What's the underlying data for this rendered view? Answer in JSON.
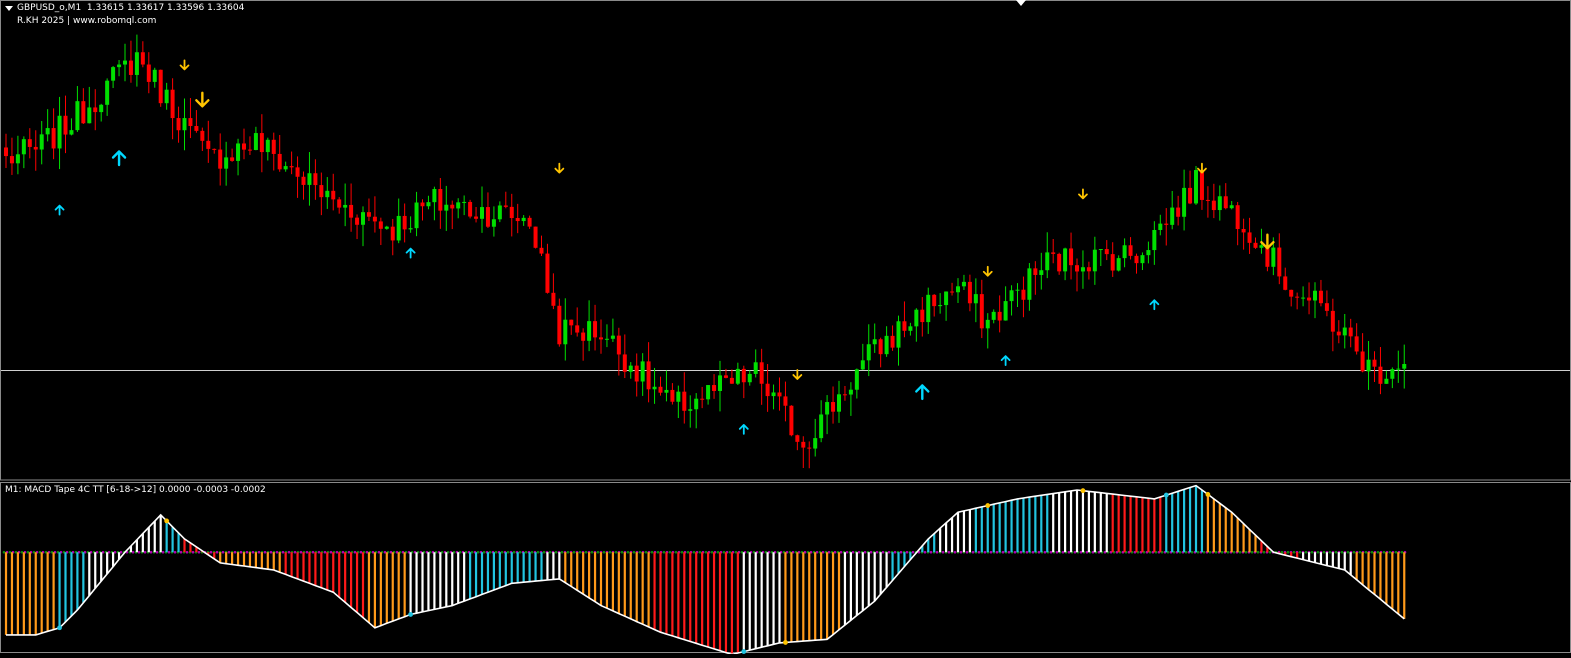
{
  "main_window": {
    "symbol_header": "GBPUSD_o,M1  1.33615 1.33617 1.33596 1.33604",
    "credit": "R.KH 2025 | www.robomql.com"
  },
  "indicator_window": {
    "header": "M1: MACD Tape 4C TT [6-18->12] 0.0000 -0.0003 -0.0002"
  },
  "colors": {
    "background": "#000000",
    "bull_candle": "#00e000",
    "bear_candle": "#ff0000",
    "buy_arrow": "#00d8ff",
    "sell_arrow": "#ffc400",
    "hline": "#d0d0d0",
    "macd_line": "#ffffff",
    "signal_dots": "#b000b0",
    "zero_dots": "#0a8a0a",
    "tape_white": "#ffffff",
    "tape_cyan": "#22c4e0",
    "tape_orange": "#ff9a1a",
    "tape_red": "#ff1a1a",
    "frame_border": "#8a8a8a"
  },
  "chart_data": [
    {
      "type": "candlestick",
      "symbol": "GBPUSD_o",
      "timeframe": "M1",
      "ylim": [
        1.335,
        1.34
      ],
      "price_levels": {
        "top": 1.34,
        "bottom": 1.335
      },
      "hline_price": 1.33604,
      "anchors": [
        [
          0,
          1.3385
        ],
        [
          5,
          1.3386
        ],
        [
          12,
          1.339
        ],
        [
          22,
          1.3397
        ],
        [
          27,
          1.3392
        ],
        [
          34,
          1.3385
        ],
        [
          42,
          1.3387
        ],
        [
          55,
          1.338
        ],
        [
          65,
          1.3377
        ],
        [
          72,
          1.338
        ],
        [
          80,
          1.3379
        ],
        [
          88,
          1.3378
        ],
        [
          93,
          1.3365
        ],
        [
          100,
          1.3365
        ],
        [
          112,
          1.3356
        ],
        [
          126,
          1.336
        ],
        [
          134,
          1.3352
        ],
        [
          145,
          1.3362
        ],
        [
          155,
          1.3368
        ],
        [
          160,
          1.337
        ],
        [
          165,
          1.3366
        ],
        [
          175,
          1.3373
        ],
        [
          190,
          1.3374
        ],
        [
          200,
          1.3382
        ],
        [
          208,
          1.3378
        ],
        [
          216,
          1.337
        ],
        [
          222,
          1.3367
        ],
        [
          230,
          1.336
        ],
        [
          235,
          1.3362
        ]
      ],
      "buy_arrows": [
        [
          9,
          1.3379
        ],
        [
          19,
          1.3385
        ],
        [
          68,
          1.3374
        ],
        [
          124,
          1.33535
        ],
        [
          154,
          1.33578
        ],
        [
          168,
          1.33615
        ],
        [
          193,
          1.3368
        ]
      ],
      "sell_arrows": [
        [
          30,
          1.3396
        ],
        [
          33,
          1.3392
        ],
        [
          93,
          1.3384
        ],
        [
          133,
          1.336
        ],
        [
          165,
          1.3372
        ],
        [
          181,
          1.3381
        ],
        [
          201,
          1.3384
        ],
        [
          212,
          1.33755
        ]
      ],
      "big_arrows": [
        19,
        33,
        154,
        212
      ]
    },
    {
      "type": "line",
      "name": "MACD Tape 4C TT",
      "params": "6-18->12",
      "values_shown": [
        0.0,
        -0.0003,
        -0.0002
      ],
      "ylim": [
        -0.0008,
        0.001
      ],
      "signal_level": 0.0003,
      "zero_level": 0.0003,
      "macd_anchors": [
        [
          0,
          -0.00063
        ],
        [
          5,
          -0.00063
        ],
        [
          9,
          -0.00055
        ],
        [
          12,
          -0.00035
        ],
        [
          20,
          0.0003
        ],
        [
          26,
          0.00072
        ],
        [
          30,
          0.00045
        ],
        [
          36,
          0.00018
        ],
        [
          45,
          0.0001
        ],
        [
          55,
          -0.00015
        ],
        [
          62,
          -0.00055
        ],
        [
          68,
          -0.0004
        ],
        [
          75,
          -0.0003
        ],
        [
          85,
          -5e-05
        ],
        [
          93,
          0.0
        ],
        [
          100,
          -0.0003
        ],
        [
          110,
          -0.0006
        ],
        [
          122,
          -0.00085
        ],
        [
          130,
          -0.00072
        ],
        [
          138,
          -0.00068
        ],
        [
          146,
          -0.00025
        ],
        [
          155,
          0.00045
        ],
        [
          160,
          0.00075
        ],
        [
          170,
          0.0009
        ],
        [
          180,
          0.001
        ],
        [
          193,
          0.0009
        ],
        [
          200,
          0.00105
        ],
        [
          206,
          0.00075
        ],
        [
          213,
          0.0003
        ],
        [
          225,
          0.0001
        ],
        [
          235,
          -0.00045
        ]
      ],
      "tape_segments": [
        [
          0,
          8,
          "orange"
        ],
        [
          9,
          13,
          "cyan"
        ],
        [
          14,
          26,
          "white"
        ],
        [
          27,
          29,
          "cyan"
        ],
        [
          30,
          35,
          "red"
        ],
        [
          36,
          46,
          "orange"
        ],
        [
          47,
          60,
          "red"
        ],
        [
          61,
          67,
          "orange"
        ],
        [
          68,
          77,
          "white"
        ],
        [
          78,
          90,
          "cyan"
        ],
        [
          91,
          93,
          "white"
        ],
        [
          94,
          108,
          "orange"
        ],
        [
          109,
          123,
          "red"
        ],
        [
          124,
          130,
          "white"
        ],
        [
          131,
          140,
          "orange"
        ],
        [
          141,
          148,
          "white"
        ],
        [
          149,
          156,
          "cyan"
        ],
        [
          157,
          162,
          "white"
        ],
        [
          163,
          175,
          "cyan"
        ],
        [
          176,
          185,
          "white"
        ],
        [
          186,
          194,
          "red"
        ],
        [
          195,
          201,
          "cyan"
        ],
        [
          202,
          210,
          "orange"
        ],
        [
          211,
          217,
          "red"
        ],
        [
          218,
          226,
          "white"
        ],
        [
          227,
          235,
          "orange"
        ]
      ],
      "color_change_dots": [
        [
          9,
          "cyan"
        ],
        [
          27,
          "orange"
        ],
        [
          68,
          "cyan"
        ],
        [
          124,
          "cyan"
        ],
        [
          131,
          "orange"
        ],
        [
          165,
          "orange"
        ],
        [
          181,
          "orange"
        ],
        [
          195,
          "cyan"
        ],
        [
          202,
          "orange"
        ]
      ]
    }
  ]
}
